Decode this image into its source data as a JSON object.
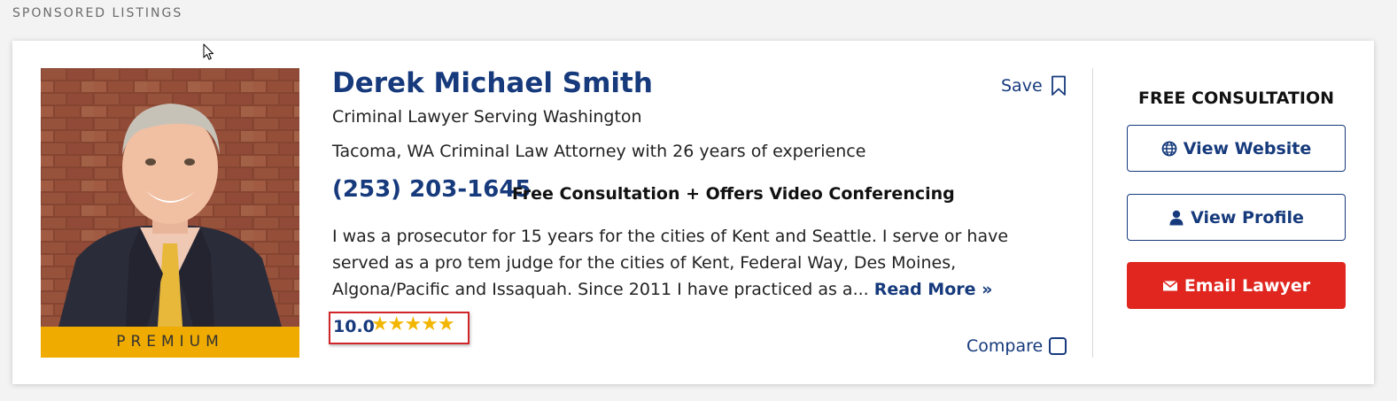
{
  "section": {
    "label": "SPONSORED LISTINGS"
  },
  "listing": {
    "name": "Derek Michael Smith",
    "subtitle": "Criminal Lawyer Serving Washington",
    "location": "Tacoma, WA Criminal Law Attorney with 26 years of experience",
    "phone": "(253) 203-1645",
    "consult_info": "Free Consultation + Offers Video Conferencing",
    "bio": "I was a prosecutor for 15 years for the cities of Kent and Seattle. I serve or have served as a pro tem judge for the cities of Kent, Federal Way, Des Moines, Algona/Pacific and Issaquah. Since 2011 I have practiced as a...",
    "read_more": "Read More »",
    "rating": "10.0",
    "stars": "★★★★★",
    "star_count": 5,
    "badge": "PREMIUM",
    "save_label": "Save",
    "compare_label": "Compare"
  },
  "sidebar": {
    "heading": "FREE CONSULTATION",
    "view_website": "View Website",
    "view_profile": "View Profile",
    "email_lawyer": "Email Lawyer"
  },
  "colors": {
    "brand_blue": "#163a7c",
    "premium_gold": "#f0ab00",
    "email_red": "#e0261f",
    "star_gold": "#f2b600",
    "highlight_red": "#d0262a"
  },
  "icons": {
    "bookmark": "bookmark-icon",
    "globe": "globe-icon",
    "user": "user-icon",
    "envelope": "envelope-icon",
    "cursor": "mouse-cursor-icon"
  }
}
